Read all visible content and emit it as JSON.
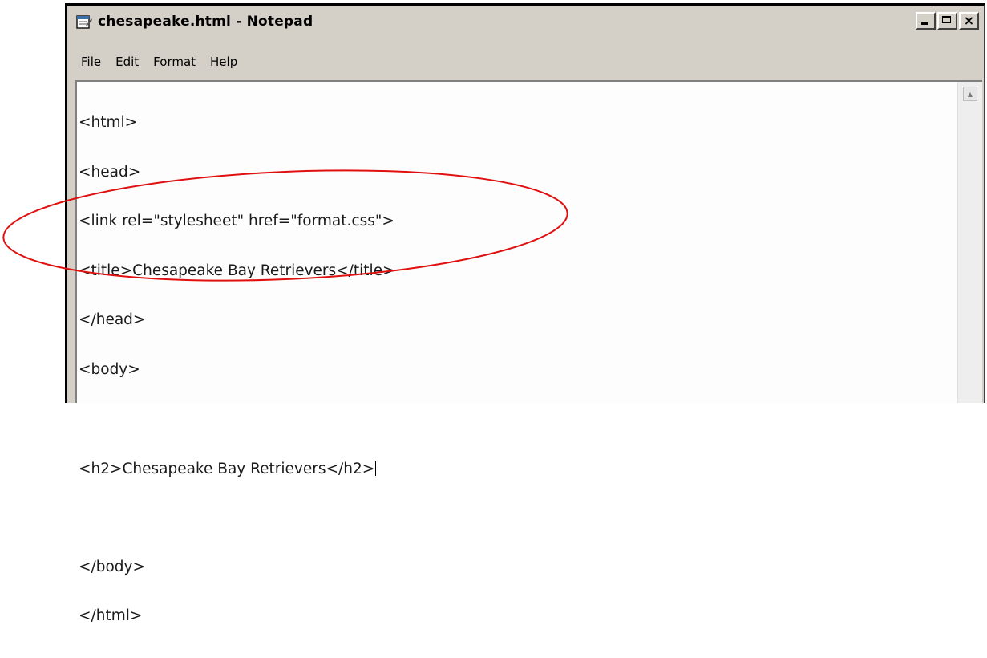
{
  "window": {
    "title": "chesapeake.html - Notepad",
    "app_icon": "notepad-icon",
    "controls": {
      "minimize": "minimize-icon",
      "maximize": "maximize-icon",
      "close_label": "×"
    }
  },
  "menu": {
    "items": [
      "File",
      "Edit",
      "Format",
      "Help"
    ]
  },
  "editor": {
    "lines": [
      "<html>",
      "<head>",
      "<link rel=\"stylesheet\" href=\"format.css\">",
      "<title>Chesapeake Bay Retrievers</title>",
      "</head>",
      "<body>",
      "",
      "<h2>Chesapeake Bay Retrievers</h2>",
      "",
      "</body>",
      "</html>"
    ],
    "caret_after_line": 7
  },
  "annotation": {
    "shape": "ellipse",
    "color": "#e01010",
    "highlights": "body-section"
  }
}
